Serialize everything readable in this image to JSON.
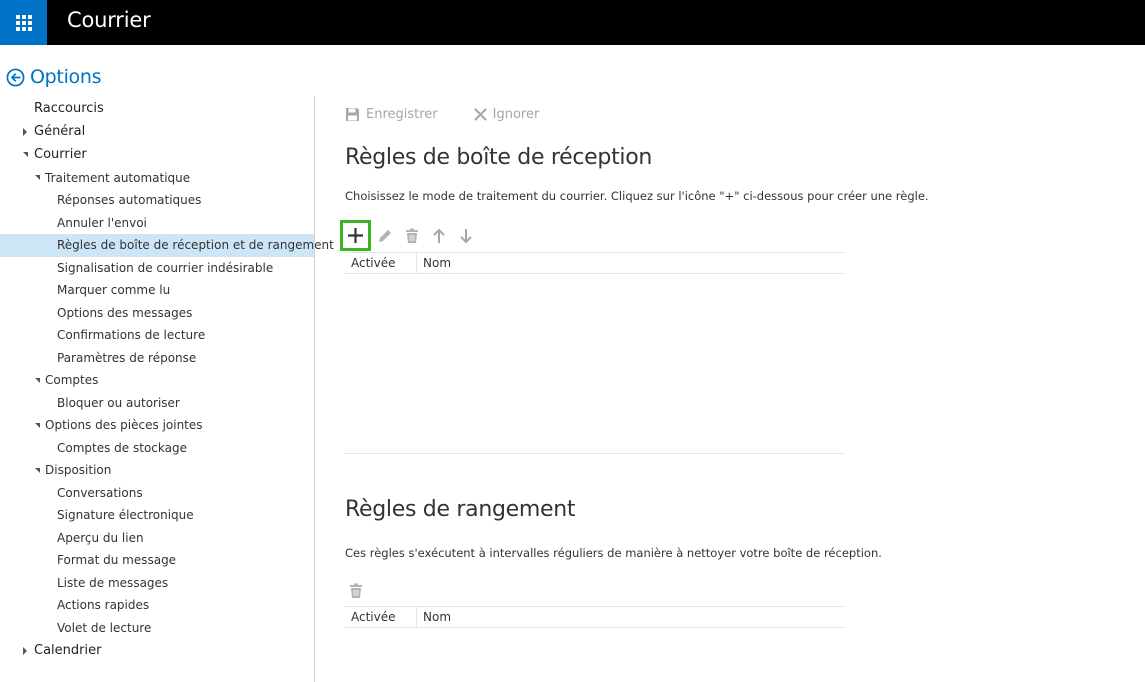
{
  "header": {
    "app_title": "Courrier",
    "launcher_icon": "waffle-icon"
  },
  "options": {
    "title": "Options",
    "back_icon": "back-arrow-circle-icon"
  },
  "nav": {
    "shortcuts": "Raccourcis",
    "general": "Général",
    "mail": "Courrier",
    "auto_processing": "Traitement automatique",
    "auto_replies": "Réponses automatiques",
    "undo_send": "Annuler l'envoi",
    "inbox_rules": "Règles de boîte de réception et de rangement",
    "junk": "Signalisation de courrier indésirable",
    "mark_read": "Marquer comme lu",
    "message_options": "Options des messages",
    "read_receipts": "Confirmations de lecture",
    "reply_settings": "Paramètres de réponse",
    "accounts": "Comptes",
    "block_allow": "Bloquer ou autoriser",
    "attachment_options": "Options des pièces jointes",
    "storage_accounts": "Comptes de stockage",
    "layout": "Disposition",
    "conversations": "Conversations",
    "signature": "Signature électronique",
    "link_preview": "Aperçu du lien",
    "message_format": "Format du message",
    "message_list": "Liste de messages",
    "quick_actions": "Actions rapides",
    "reading_pane": "Volet de lecture",
    "calendar": "Calendrier"
  },
  "commands": {
    "save": "Enregistrer",
    "discard": "Ignorer"
  },
  "inbox_rules": {
    "title": "Règles de boîte de réception",
    "description": "Choisissez le mode de traitement du courrier. Cliquez sur l'icône \"+\" ci-dessous pour créer une règle.",
    "col_enabled": "Activée",
    "col_name": "Nom"
  },
  "sweep_rules": {
    "title": "Règles de rangement",
    "description": "Ces règles s'exécutent à intervalles réguliers de manière à nettoyer votre boîte de réception.",
    "col_enabled": "Activée",
    "col_name": "Nom"
  },
  "colors": {
    "brand_blue": "#0072c6",
    "highlight_green": "#3bb41f",
    "selected_bg": "#cde6f7"
  }
}
